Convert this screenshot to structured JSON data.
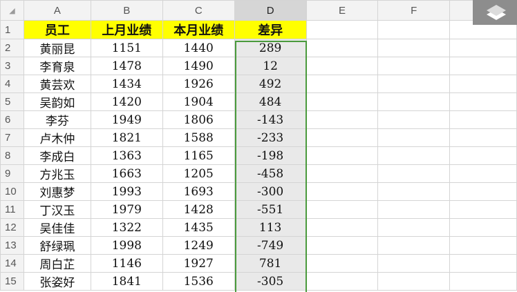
{
  "columns": [
    "A",
    "B",
    "C",
    "D",
    "E",
    "F"
  ],
  "selected_column": "D",
  "corner_glyph": "◢",
  "header_row": {
    "row": "1",
    "cells": [
      "员工",
      "上月业绩",
      "本月业绩",
      "差异"
    ]
  },
  "rows": [
    {
      "row": "2",
      "name": "黄丽昆",
      "last": "1151",
      "this": "1440",
      "diff": "289"
    },
    {
      "row": "3",
      "name": "李育泉",
      "last": "1478",
      "this": "1490",
      "diff": "12"
    },
    {
      "row": "4",
      "name": "黄芸欢",
      "last": "1434",
      "this": "1926",
      "diff": "492"
    },
    {
      "row": "5",
      "name": "吴韵如",
      "last": "1420",
      "this": "1904",
      "diff": "484"
    },
    {
      "row": "6",
      "name": "李芬",
      "last": "1949",
      "this": "1806",
      "diff": "-143"
    },
    {
      "row": "7",
      "name": "卢木仲",
      "last": "1821",
      "this": "1588",
      "diff": "-233"
    },
    {
      "row": "8",
      "name": "李成白",
      "last": "1363",
      "this": "1165",
      "diff": "-198"
    },
    {
      "row": "9",
      "name": "方兆玉",
      "last": "1663",
      "this": "1205",
      "diff": "-458"
    },
    {
      "row": "10",
      "name": "刘惠梦",
      "last": "1993",
      "this": "1693",
      "diff": "-300"
    },
    {
      "row": "11",
      "name": "丁汉玉",
      "last": "1979",
      "this": "1428",
      "diff": "-551"
    },
    {
      "row": "12",
      "name": "吴佳佳",
      "last": "1322",
      "this": "1435",
      "diff": "113"
    },
    {
      "row": "13",
      "name": "舒绿珮",
      "last": "1998",
      "this": "1249",
      "diff": "-749"
    },
    {
      "row": "14",
      "name": "周白芷",
      "last": "1146",
      "this": "1927",
      "diff": "781"
    },
    {
      "row": "15",
      "name": "张姿好",
      "last": "1841",
      "this": "1536",
      "diff": "-305"
    }
  ],
  "colors": {
    "header_fill": "#ffff00",
    "selection_border": "#4a9a3c",
    "selection_fill": "#e9e9e9"
  },
  "overlay_icon": "app-logo-icon"
}
